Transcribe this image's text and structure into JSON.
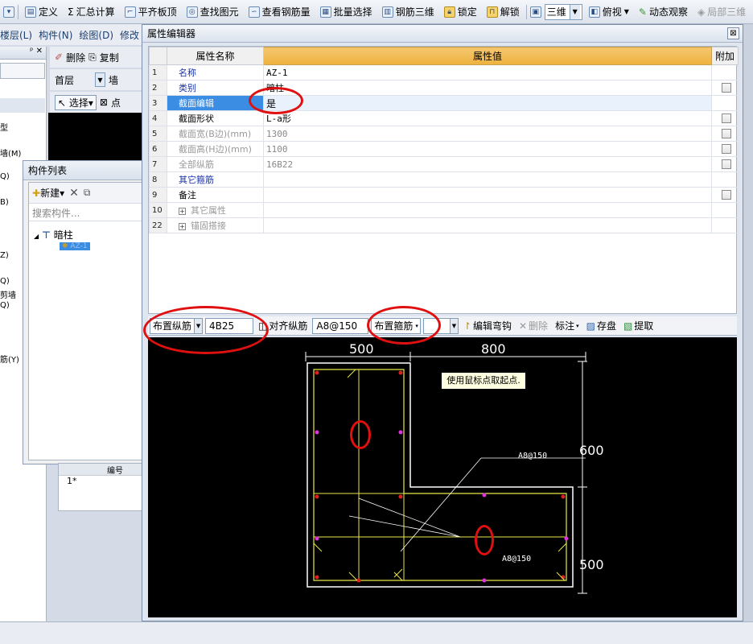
{
  "toolbar": {
    "items": [
      {
        "label": "定义",
        "icon": "define-icon"
      },
      {
        "label": "汇总计算",
        "icon": "sigma-icon"
      },
      {
        "label": "平齐板顶",
        "icon": "flush-top-icon"
      },
      {
        "label": "查找图元",
        "icon": "binoculars-icon"
      },
      {
        "label": "查看钢筋量",
        "icon": "view-rebar-icon"
      },
      {
        "label": "批量选择",
        "icon": "batch-select-icon"
      },
      {
        "label": "钢筋三维",
        "icon": "rebar-3d-icon"
      },
      {
        "label": "锁定",
        "icon": "lock-icon"
      },
      {
        "label": "解锁",
        "icon": "unlock-icon"
      }
    ],
    "view_combo": "三维",
    "top_view": "俯视",
    "dynamic_view": "动态观察",
    "partial_3d": "局部三维"
  },
  "menubar": {
    "items": [
      "楼层(L)",
      "构件(N)",
      "绘图(D)",
      "修改"
    ]
  },
  "mid_toolbar": {
    "delete": "删除",
    "copy": "复制",
    "floor": "首层",
    "wall": "墙",
    "select": "选择",
    "point": "点"
  },
  "left_panel": {
    "pin": "ᵖ",
    "close": "✕",
    "items": [
      "型",
      "墙(M)",
      "Q)",
      "B)",
      "Z)",
      "Q)",
      "剪墙",
      "Q)",
      "筋(Y)"
    ]
  },
  "comp_list": {
    "title": "构件列表",
    "new_label": "新建",
    "search_placeholder": "搜索构件...",
    "tree_root": "暗柱",
    "tree_child": "AZ-1"
  },
  "under_table": {
    "header": "编号",
    "row": "1*"
  },
  "prop_editor": {
    "title": "属性编辑器",
    "columns": {
      "name": "属性名称",
      "value": "属性值",
      "extra": "附加"
    },
    "rows": [
      {
        "num": "1",
        "name": "名称",
        "value": "AZ-1",
        "style": "blue",
        "check": false
      },
      {
        "num": "2",
        "name": "类别",
        "value": "暗柱",
        "style": "blue",
        "check": true
      },
      {
        "num": "3",
        "name": "截面编辑",
        "value": "是",
        "style": "blue",
        "check": false,
        "selected": true
      },
      {
        "num": "4",
        "name": "截面形状",
        "value": "L-a形",
        "style": "dark",
        "check": true
      },
      {
        "num": "5",
        "name": "截面宽(B边)(mm)",
        "value": "1300",
        "style": "gray",
        "check": true
      },
      {
        "num": "6",
        "name": "截面高(H边)(mm)",
        "value": "1100",
        "style": "gray",
        "check": true
      },
      {
        "num": "7",
        "name": "全部纵筋",
        "value": "16B22",
        "style": "gray",
        "check": true
      },
      {
        "num": "8",
        "name": "其它箍筋",
        "value": "",
        "style": "blue",
        "check": false
      },
      {
        "num": "9",
        "name": "备注",
        "value": "",
        "style": "dark",
        "check": true
      },
      {
        "num": "10",
        "name": "其它属性",
        "value": "",
        "style": "gray",
        "check": false,
        "expand": true
      },
      {
        "num": "22",
        "name": "锚固搭接",
        "value": "",
        "style": "gray",
        "check": false,
        "expand": true
      }
    ],
    "bar": {
      "longitudinal_combo": "布置纵筋",
      "longitudinal_value": "4B25",
      "align_label": "对齐纵筋",
      "stirrup_value": "A8@150",
      "stirrup_combo": "布置箍筋",
      "edit_hook": "编辑弯钩",
      "delete": "删除",
      "annotate": "标注",
      "save": "存盘",
      "extract": "提取"
    },
    "drawing": {
      "dim_top_left": "500",
      "dim_top_right": "800",
      "dim_right_top": "600",
      "dim_right_bottom": "500",
      "label_1": "A8@150",
      "label_2": "A8@150",
      "tooltip": "使用鼠标点取起点."
    }
  },
  "colors": {
    "highlight": "#3b8ce3",
    "header": "#eeb23d",
    "annotation_red": "#e01010",
    "rebar_yellow": "#e8e84a"
  }
}
